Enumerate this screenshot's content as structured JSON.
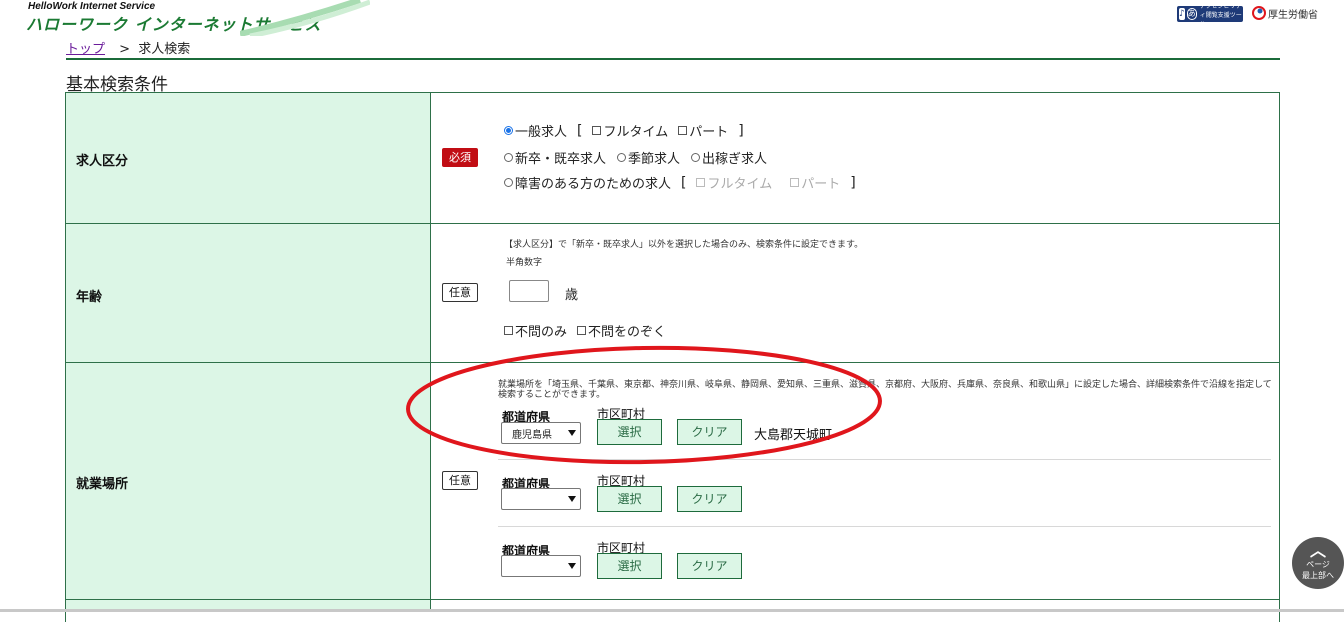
{
  "header": {
    "logo_sub": "HelloWork Internet Service",
    "logo_main": "ハローワーク インターネットサービス",
    "accessibility_badge": "アクセシビリティ閲覧支援ツール",
    "ministry": "厚生労働省"
  },
  "breadcrumb": {
    "home": "トップ",
    "separator": ">",
    "current": "求人検索"
  },
  "section_title": "基本検索条件",
  "job_category": {
    "label": "求人区分",
    "badge": "必須",
    "options": {
      "general": "一般求人",
      "fulltime": "フルタイム",
      "parttime": "パート",
      "newgrad": "新卒・既卒求人",
      "seasonal": "季節求人",
      "migrant": "出稼ぎ求人",
      "disabled": "障害のある方のための求人",
      "dis_fulltime": "フルタイム",
      "dis_parttime": "パート"
    },
    "selected": "一般求人"
  },
  "age": {
    "label": "年齢",
    "badge": "任意",
    "note": "【求人区分】で「新卒・既卒求人」以外を選択した場合のみ、検索条件に設定できます。",
    "hint": "半角数字",
    "value": "",
    "unit": "歳",
    "any_only": "不問のみ",
    "exclude_any": "不問をのぞく"
  },
  "location": {
    "label": "就業場所",
    "badge": "任意",
    "note": "就業場所を「埼玉県、千葉県、東京都、神奈川県、岐阜県、静岡県、愛知県、三重県、滋賀県、京都府、大阪府、兵庫県、奈良県、和歌山県」に設定した場合、詳細検索条件で沿線を指定して検索することができます。",
    "pref_label": "都道府県",
    "city_label": "市区町村",
    "select_button": "選択",
    "clear_button": "クリア",
    "rows": [
      {
        "prefecture": "鹿児島県",
        "city": "大島郡天城町"
      },
      {
        "prefecture": "",
        "city": ""
      },
      {
        "prefecture": "",
        "city": ""
      }
    ]
  },
  "scroll_top": {
    "line1": "ページ",
    "line2": "最上部へ"
  },
  "colors": {
    "brand_green": "#1b7a33",
    "label_bg": "#dcf6e6",
    "required_red": "#c10d14",
    "annotation_red": "#e0161c"
  }
}
